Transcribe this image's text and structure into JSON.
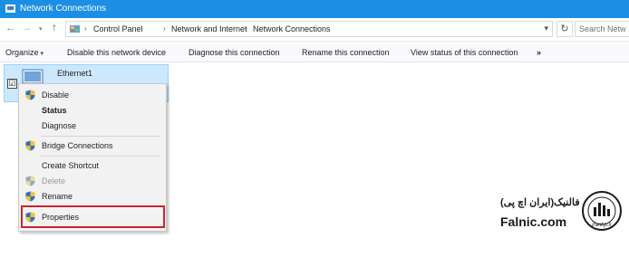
{
  "window": {
    "title": "Network Connections"
  },
  "address": {
    "crumbs": [
      "Control Panel",
      "Network and Internet",
      "Network Connections"
    ],
    "search_placeholder": "Search Netw"
  },
  "toolbar": {
    "organize": "Organize",
    "disable": "Disable this network device",
    "diagnose": "Diagnose this connection",
    "rename": "Rename this connection",
    "view_status": "View status of this connection",
    "more": "»"
  },
  "adapter": {
    "name": "Ethernet1",
    "checked": "☑"
  },
  "context_menu": {
    "disable": "Disable",
    "status": "Status",
    "diagnose": "Diagnose",
    "bridge": "Bridge Connections",
    "shortcut": "Create Shortcut",
    "delete": "Delete",
    "rename": "Rename",
    "properties": "Properties"
  },
  "watermark": {
    "persian": "فالنیک(ایران اچ پی)",
    "brand": "Falnic.com",
    "logo_text": "iranhp.ir"
  },
  "colors": {
    "titlebar": "#1c8fe4",
    "selection": "#cce8ff",
    "highlight_border": "#c8262c"
  }
}
